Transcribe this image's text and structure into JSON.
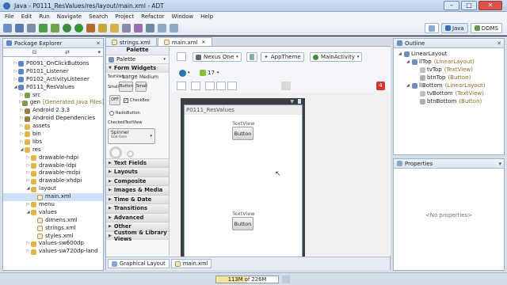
{
  "window": {
    "title": "Java - P0111_ResValues/res/layout/main.xml - ADT",
    "minimize": "–",
    "maximize": "□",
    "close": "✕"
  },
  "menu": [
    "File",
    "Edit",
    "Run",
    "Navigate",
    "Search",
    "Project",
    "Refactor",
    "Window",
    "Help"
  ],
  "perspectives": {
    "java": "Java",
    "ddms": "DDMS"
  },
  "explorer": {
    "title": "Package Explorer",
    "close": "✕",
    "items": [
      {
        "label": "P0091_OnClickButtons",
        "depth": 0,
        "icon": "project-icon"
      },
      {
        "label": "P0101_Listener",
        "depth": 0,
        "icon": "project-icon"
      },
      {
        "label": "P0102_ActivityListener",
        "depth": 0,
        "icon": "project-icon"
      },
      {
        "label": "P0111_ResValues",
        "depth": 0,
        "icon": "project-icon"
      },
      {
        "label": "src",
        "depth": 1,
        "icon": "source-folder-icon"
      },
      {
        "label": "gen",
        "hint": "[Generated Java Files]",
        "depth": 1,
        "icon": "source-folder-icon"
      },
      {
        "label": "Android 2.3.3",
        "depth": 1,
        "icon": "library-icon"
      },
      {
        "label": "Android Dependencies",
        "depth": 1,
        "icon": "library-icon"
      },
      {
        "label": "assets",
        "depth": 1,
        "icon": "folder-icon"
      },
      {
        "label": "bin",
        "depth": 1,
        "icon": "folder-icon"
      },
      {
        "label": "libs",
        "depth": 1,
        "icon": "folder-icon"
      },
      {
        "label": "res",
        "depth": 1,
        "icon": "folder-icon"
      },
      {
        "label": "drawable-hdpi",
        "depth": 2,
        "icon": "folder-icon"
      },
      {
        "label": "drawable-ldpi",
        "depth": 2,
        "icon": "folder-icon"
      },
      {
        "label": "drawable-mdpi",
        "depth": 2,
        "icon": "folder-icon"
      },
      {
        "label": "drawable-xhdpi",
        "depth": 2,
        "icon": "folder-icon"
      },
      {
        "label": "layout",
        "depth": 2,
        "icon": "folder-icon"
      },
      {
        "label": "main.xml",
        "depth": 3,
        "icon": "xml-file-icon"
      },
      {
        "label": "menu",
        "depth": 2,
        "icon": "folder-icon"
      },
      {
        "label": "values",
        "depth": 2,
        "icon": "folder-icon"
      },
      {
        "label": "dimens.xml",
        "depth": 3,
        "icon": "xml-file-icon"
      },
      {
        "label": "strings.xml",
        "depth": 3,
        "icon": "xml-file-icon"
      },
      {
        "label": "styles.xml",
        "depth": 3,
        "icon": "xml-file-icon"
      },
      {
        "label": "values-sw600dp",
        "depth": 2,
        "icon": "folder-icon"
      },
      {
        "label": "values-sw720dp-land",
        "depth": 2,
        "icon": "folder-icon"
      }
    ]
  },
  "editor_tabs": [
    {
      "label": "strings.xml"
    },
    {
      "label": "main.xml"
    }
  ],
  "palette": {
    "title": "Palette",
    "header": "Palette",
    "form_widgets": "Form Widgets",
    "widgets": {
      "textview_small": "TextView",
      "large": "Large",
      "medium": "Medium",
      "small": "Small",
      "button": "Button",
      "small_button": "Small",
      "toggle": "OFF",
      "checkbox": "CheckBox",
      "radio": "RadioButton",
      "checkedtext": "CheckedTextView",
      "spinner": "Spinner",
      "spinner_sub": "Sub Item"
    },
    "categories": [
      "Text Fields",
      "Layouts",
      "Composite",
      "Images & Media",
      "Time & Date",
      "Transitions",
      "Advanced",
      "Other",
      "Custom & Library Views"
    ]
  },
  "editor_toolbar": {
    "device": "Nexus One",
    "theme": "AppTheme",
    "activity": "MainActivity",
    "api": "17"
  },
  "preview": {
    "app_title": "P0111_ResValues",
    "top": {
      "text": "TextView",
      "button": "Button"
    },
    "bottom": {
      "text": "TextView",
      "button": "Button"
    }
  },
  "bottom_tabs": [
    "Graphical Layout",
    "main.xml"
  ],
  "outline": {
    "title": "Outline",
    "items": [
      {
        "label": "LinearLayout",
        "depth": 0
      },
      {
        "label": "llTop",
        "hint": "(LinearLayout)",
        "depth": 1
      },
      {
        "label": "tvTop",
        "hint": "(TextView)",
        "depth": 2
      },
      {
        "label": "btnTop",
        "hint": "(Button)",
        "depth": 2
      },
      {
        "label": "llBottom",
        "hint": "(LinearLayout)",
        "depth": 1
      },
      {
        "label": "tvBottom",
        "hint": "(TextView)",
        "depth": 2
      },
      {
        "label": "btnBottom",
        "hint": "(Button)",
        "depth": 2
      }
    ]
  },
  "properties": {
    "title": "Properties",
    "empty": "<No properties>"
  },
  "status": {
    "memory": "113M of 226M",
    "memory_fraction": 0.5
  },
  "colors": {
    "title_bar": "#cfe0f2",
    "selected": "#cfe1f7",
    "hint": "#8b6c25"
  }
}
